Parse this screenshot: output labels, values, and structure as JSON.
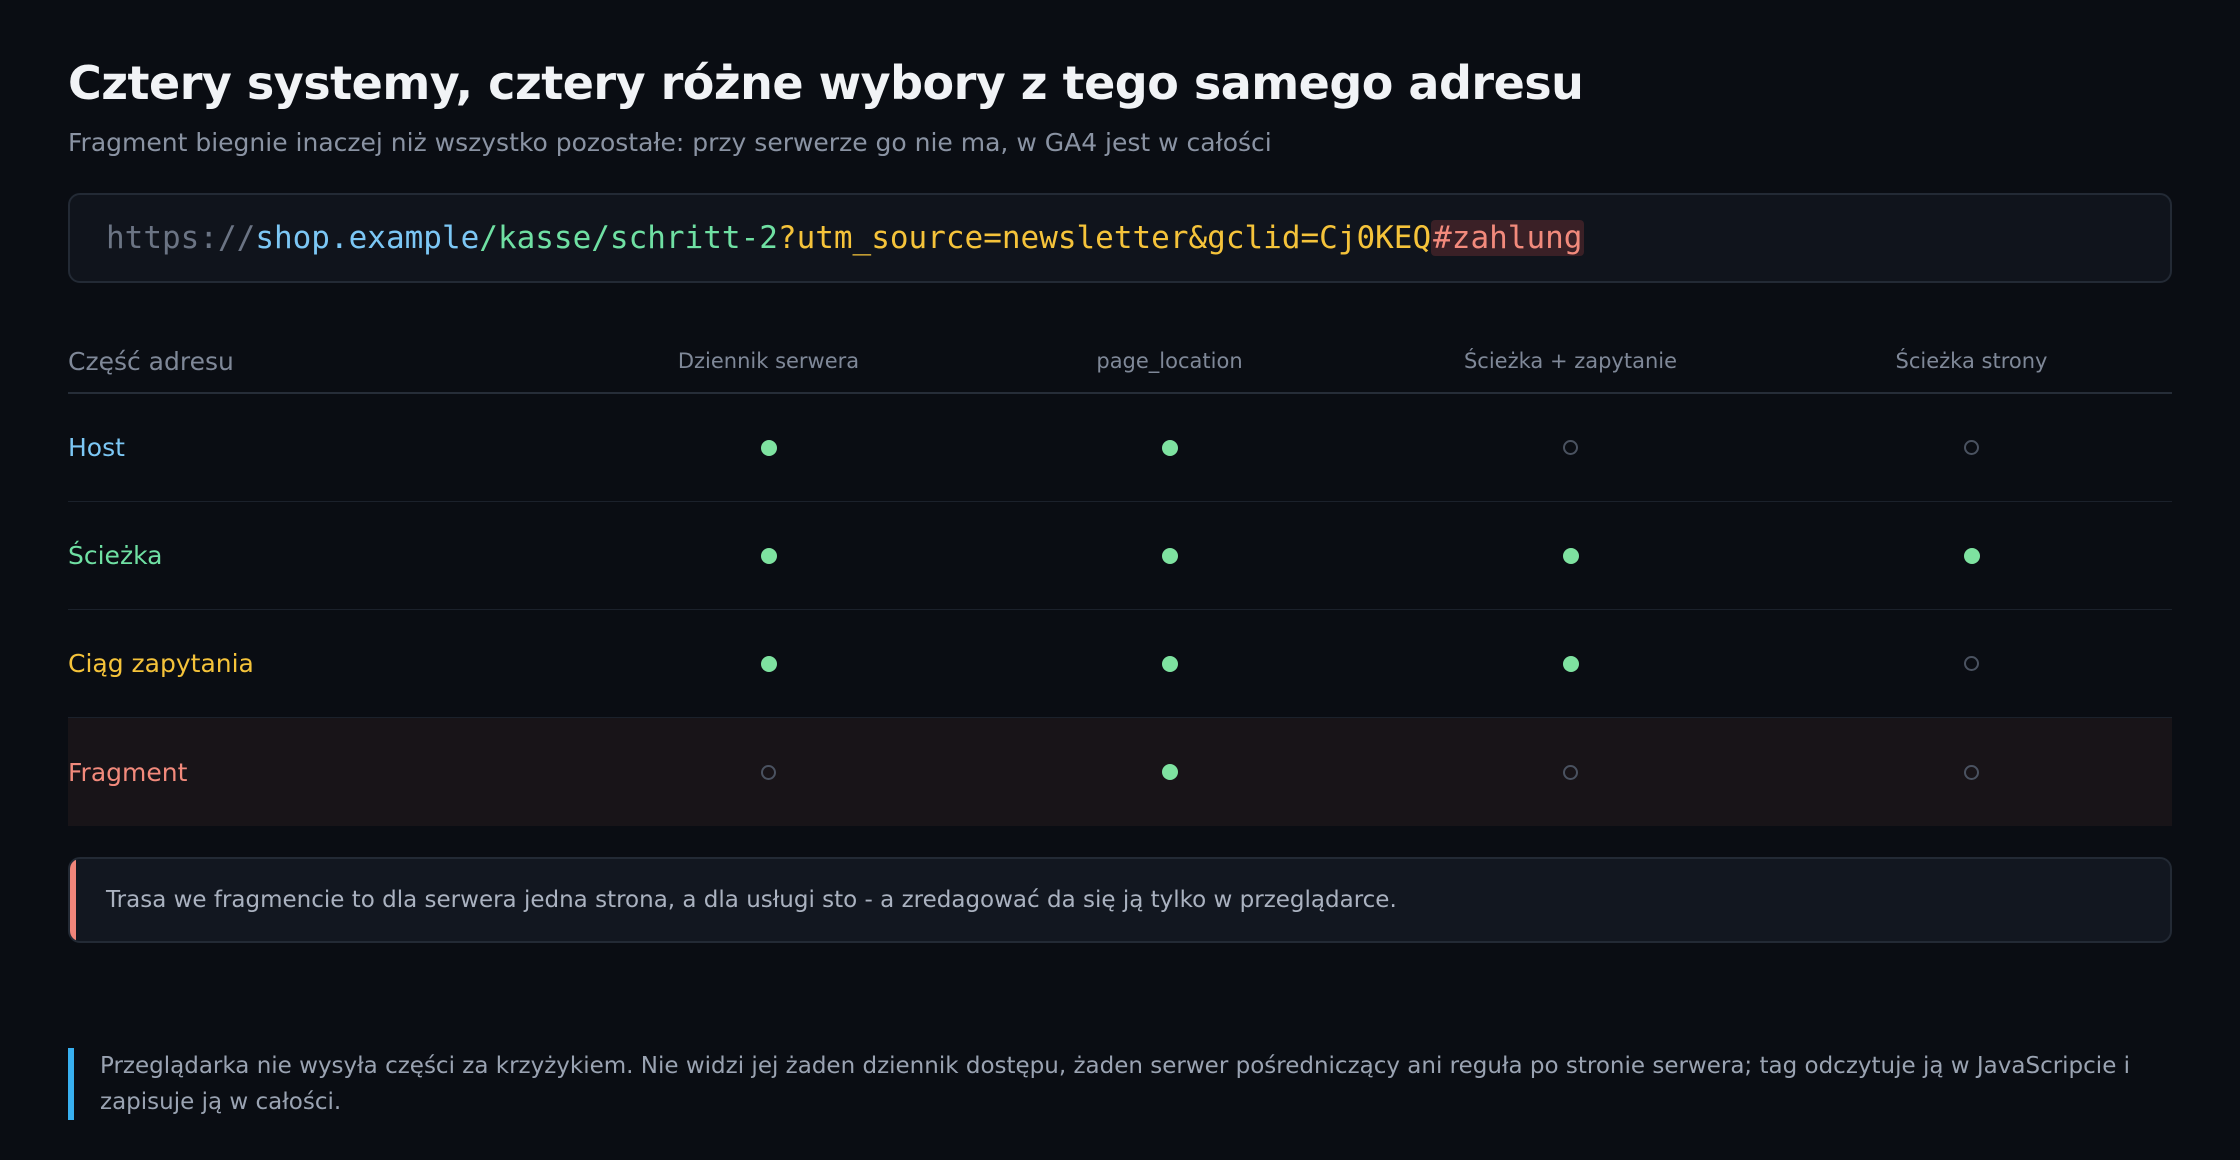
{
  "header": {
    "title": "Cztery systemy, cztery różne wybory z tego samego adresu",
    "subtitle": "Fragment biegnie inaczej niż wszystko pozostałe: przy serwerze go nie ma, w GA4 jest w całości"
  },
  "url": {
    "scheme": "https://",
    "host": "shop.example",
    "path": "/kasse/schritt-2",
    "query": "?utm_source=newsletter&gclid=Cj0KEQ",
    "fragment": "#zahlung"
  },
  "table": {
    "part_header": "Część adresu",
    "columns": [
      "Dziennik serwera",
      "page_location",
      "Ścieżka + zapytanie",
      "Ścieżka strony"
    ],
    "rows": [
      {
        "label": "Host",
        "color": "#7cc7f5",
        "values": [
          true,
          true,
          false,
          false
        ]
      },
      {
        "label": "Ścieżka",
        "color": "#6fe0a3",
        "values": [
          true,
          true,
          true,
          true
        ]
      },
      {
        "label": "Ciąg zapytania",
        "color": "#f5c33a",
        "values": [
          true,
          true,
          true,
          false
        ]
      },
      {
        "label": "Fragment",
        "color": "#f28a7c",
        "values": [
          false,
          true,
          false,
          false
        ],
        "highlighted": true
      }
    ]
  },
  "note": {
    "text": "Trasa we fragmencie to dla serwera jedna strona, a dla usługi sto - a zredagować da się ją tylko w przeglądarce.",
    "accent": "#f0857a"
  },
  "footer": {
    "text": "Przeglądarka nie wysyła części za krzyżykiem. Nie widzi jej żaden dziennik dostępu, żaden serwer pośredniczący ani reguła po stronie serwera; tag odczytuje ją w JavaScripcie i zapisuje ją w całości.",
    "accent": "#38b0f0"
  }
}
